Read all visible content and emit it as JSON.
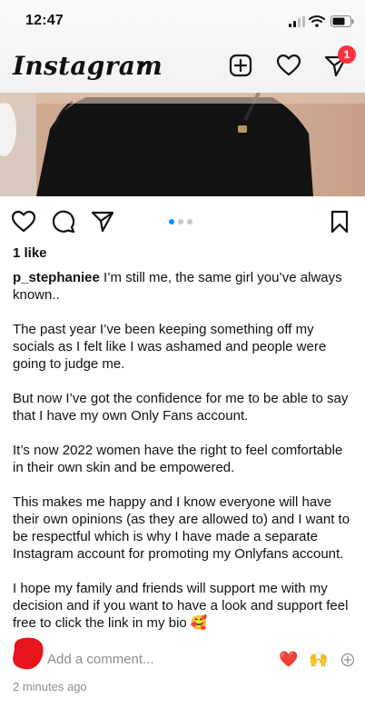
{
  "status_bar": {
    "time": "12:47"
  },
  "header": {
    "app_title": "Instagram",
    "notification_count": "1"
  },
  "post": {
    "likes": "1 like",
    "username": "p_stephaniee",
    "caption_paragraphs": [
      "I’m still me, the same girl you’ve always known..",
      "The past year I’ve been keeping something off my socials as I felt like I was ashamed and people were going to judge me.",
      "But now I’ve got the confidence for me to be able to say that I have my own Only Fans account.",
      "It’s now 2022 women have the right to feel comfortable in their own skin and be empowered.",
      "This makes me happy and I know everyone will have their own opinions (as they are allowed to) and I want to be respectful which is why I have made a separate Instagram account for promoting my Onlyfans account.",
      "I hope my family and friends will support me with my decision and if you want to have a look and support feel free to click the link in my bio 🥰"
    ],
    "carousel": {
      "total": 3,
      "active": 1
    },
    "comment_placeholder": "Add a comment...",
    "quick_reactions": [
      "❤️",
      "🙌"
    ],
    "timestamp": "2 minutes ago"
  },
  "colors": {
    "accent": "#0095f6",
    "badge": "#ff3040",
    "muted": "#8e8e8e",
    "redaction": "#e8141e"
  },
  "icons": [
    "signal-icon",
    "wifi-icon",
    "battery-icon",
    "chevron-down-icon",
    "new-post-icon",
    "heart-icon",
    "send-icon",
    "like-icon",
    "comment-icon",
    "share-icon",
    "bookmark-icon",
    "add-icon"
  ]
}
